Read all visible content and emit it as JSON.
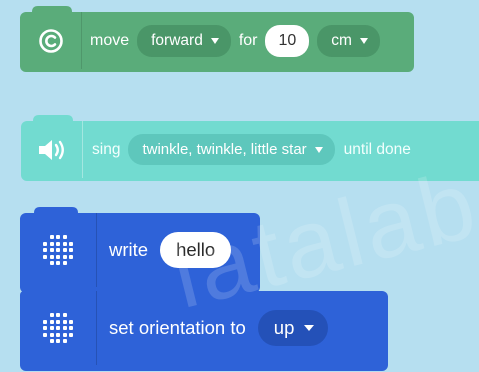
{
  "colors": {
    "background": "#b6dff0",
    "motion_block": "#5aac7a",
    "sound_block": "#72dbd0",
    "display_block": "#2e62d8"
  },
  "blocks": [
    {
      "category_icon": "copyright-icon",
      "label_1": "move",
      "direction": "forward",
      "label_2": "for",
      "distance": "10",
      "unit": "cm"
    },
    {
      "category_icon": "speaker-icon",
      "label_1": "sing",
      "song": "twinkle, twinkle, little star",
      "label_2": "until done"
    },
    {
      "category_icon": "led-matrix-icon",
      "label_1": "write",
      "text_value": "hello"
    },
    {
      "category_icon": "led-matrix-icon",
      "label_1": "set orientation to",
      "orientation": "up"
    }
  ],
  "watermark": "latalab"
}
